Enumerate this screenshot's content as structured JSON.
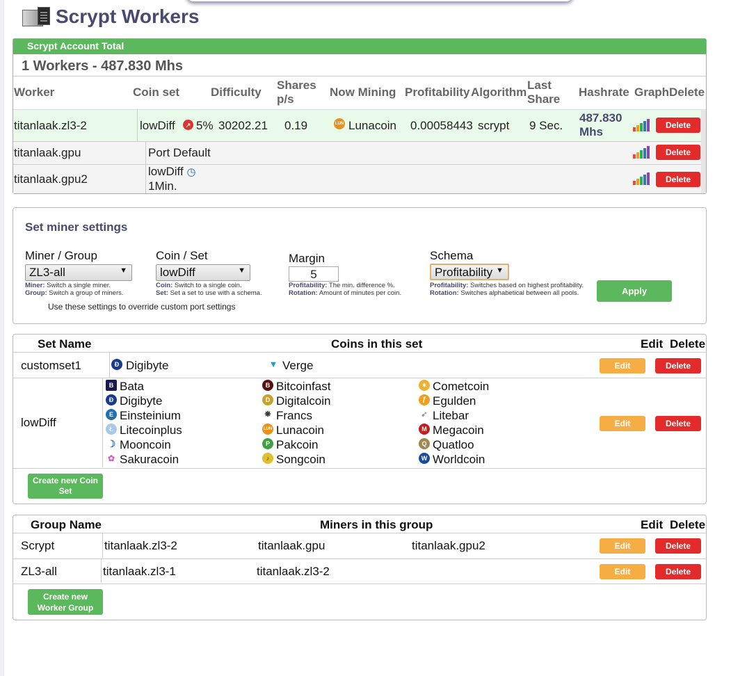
{
  "header": {
    "title": "Scrypt Workers"
  },
  "workers": {
    "panel_title": "Scrypt Account Total",
    "summary": "1 Workers - 487.830 Mhs",
    "columns": {
      "worker": "Worker",
      "coin_set": "Coin set",
      "difficulty": "Difficulty",
      "shares_a": "Shares",
      "shares_b": "p/s",
      "now_mining": "Now Mining",
      "profitability": "Profitability",
      "algorithm": "Algorithm",
      "last_a": "Last",
      "last_b": "Share",
      "hashrate": "Hashrate",
      "graph": "Graph",
      "delete": "Delete"
    },
    "rows": [
      {
        "worker": "titanlaak.zl3-2",
        "coin_set": "lowDiff",
        "pct": "5%",
        "difficulty": "30202.21",
        "shares": "0.19",
        "now_mining": "Lunacoin",
        "profitability": "0.00058443",
        "algorithm": "scrypt",
        "last_share": "9 Sec.",
        "hashrate_a": "487.830",
        "hashrate_b": "Mhs",
        "delete": "Delete"
      },
      {
        "worker": "titanlaak.gpu",
        "coin_set": "Port Default",
        "delete": "Delete"
      },
      {
        "worker": "titanlaak.gpu2",
        "coin_set": "lowDiff",
        "coin_set_b": "1Min.",
        "delete": "Delete"
      }
    ]
  },
  "settings": {
    "title": "Set miner settings",
    "miner_group": {
      "label": "Miner / Group",
      "value": "ZL3-all",
      "hint1_b": "Miner:",
      "hint1": " Switch a single miner.",
      "hint2_b": "Group:",
      "hint2": " Switch a group of miners."
    },
    "coin_set": {
      "label": "Coin / Set",
      "value": "lowDiff",
      "hint1_b": "Coin:",
      "hint1": " Switch to a single coin.",
      "hint2_b": "Set:",
      "hint2": " Set a set to use with a schema."
    },
    "margin": {
      "label": "Margin",
      "value": "5",
      "hint1_b": "Profitability:",
      "hint1": " The min. difference %.",
      "hint2_b": "Rotation:",
      "hint2": " Amount of minutes per coin."
    },
    "schema": {
      "label": "Schema",
      "value": "Profitability",
      "hint1_b": "Profitability:",
      "hint1": " Switches based on highest profitability.",
      "hint2_b": "Rotation:",
      "hint2": " Switches alphabetical between all pools."
    },
    "apply": "Apply",
    "note": "Use these settings to override custom port settings"
  },
  "coinsets": {
    "headers": {
      "name": "Set Name",
      "coins": "Coins in this set",
      "edit": "Edit",
      "delete": "Delete"
    },
    "sets": [
      {
        "name": "customset1",
        "coins": [
          "Digibyte",
          "Verge"
        ],
        "edit": "Edit",
        "delete": "Delete"
      },
      {
        "name": "lowDiff",
        "coins": [
          "Bata",
          "Bitcoinfast",
          "Cometcoin",
          "Digibyte",
          "Digitalcoin",
          "Egulden",
          "Einsteinium",
          "Francs",
          "Litebar",
          "Litecoinplus",
          "Lunacoin",
          "Megacoin",
          "Mooncoin",
          "Pakcoin",
          "Quatloo",
          "Sakuracoin",
          "Songcoin",
          "Worldcoin"
        ],
        "edit": "Edit",
        "delete": "Delete"
      }
    ],
    "create_a": "Create new Coin",
    "create_b": "Set"
  },
  "groups": {
    "headers": {
      "name": "Group Name",
      "miners": "Miners in this group",
      "edit": "Edit",
      "delete": "Delete"
    },
    "rows": [
      {
        "name": "Scrypt",
        "miners": [
          "titanlaak.zl3-2",
          "titanlaak.gpu",
          "titanlaak.gpu2"
        ],
        "edit": "Edit",
        "delete": "Delete"
      },
      {
        "name": "ZL3-all",
        "miners": [
          "titanlaak.zl3-1",
          "titanlaak.zl3-2"
        ],
        "edit": "Edit",
        "delete": "Delete"
      }
    ],
    "create_a": "Create new",
    "create_b": "Worker Group"
  }
}
